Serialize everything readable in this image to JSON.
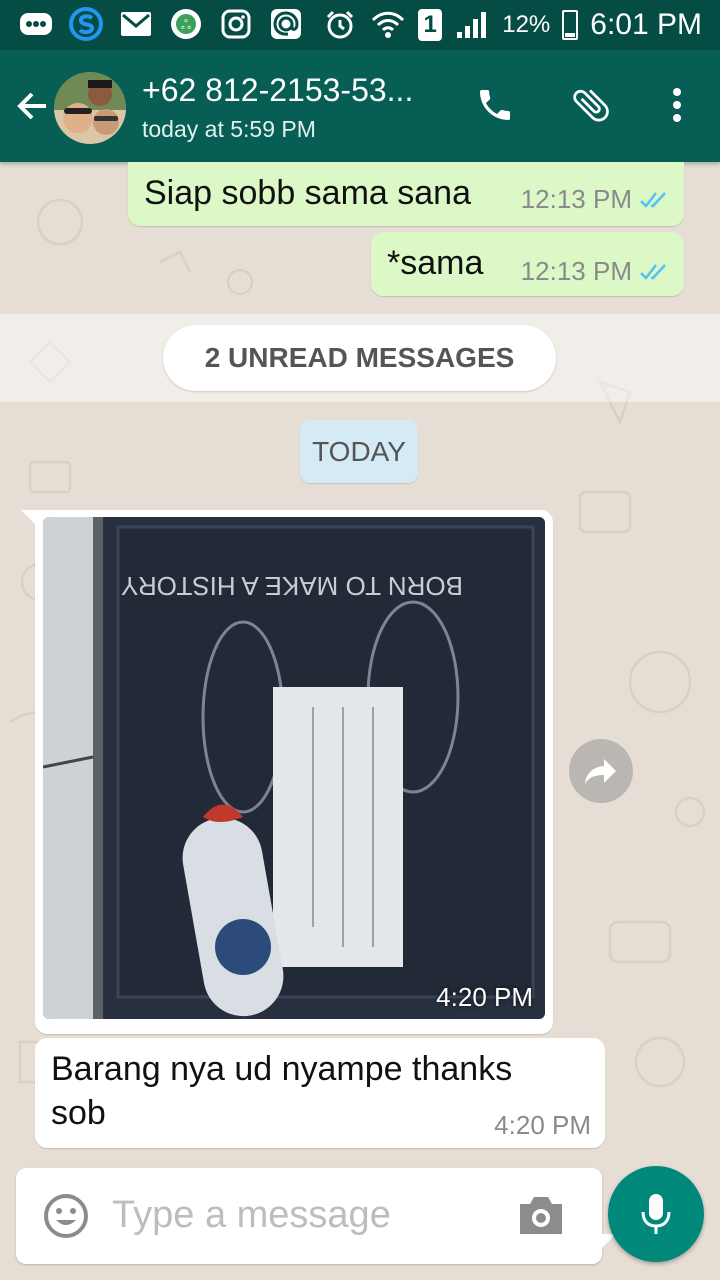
{
  "status_bar": {
    "left_icons": [
      "chat-dots-icon",
      "s-app-icon",
      "gmail-icon",
      "app-icon",
      "instagram-icon",
      "at-icon"
    ],
    "sim_label": "1",
    "battery": "12%",
    "time": "6:01 PM"
  },
  "header": {
    "contact": "+62 812-2153-53...",
    "last_seen": "today at 5:59 PM"
  },
  "messages": [
    {
      "text": "Siap sobb sama sana",
      "time": "12:13 PM"
    },
    {
      "text": "*sama",
      "time": "12:13 PM"
    }
  ],
  "unread_label": "2 UNREAD MESSAGES",
  "date_label": "TODAY",
  "image_message": {
    "time": "4:20 PM",
    "printed_text": "BORN TO MAKE A HISTORY"
  },
  "incoming": {
    "text_line1": "Barang nya ud nyampe thanks",
    "text_line2": "sob",
    "time": "4:20 PM"
  },
  "composer": {
    "placeholder": "Type a message"
  },
  "colors": {
    "header": "#075e54",
    "status": "#054d44",
    "outgoing": "#dcf8c6",
    "accent": "#00897b",
    "ticks": "#4fc3f7"
  }
}
